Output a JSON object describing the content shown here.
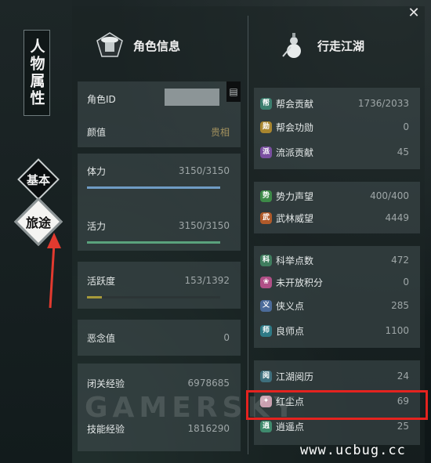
{
  "sidebar": {
    "title": "人物属性",
    "tabs": [
      {
        "label": "基本"
      },
      {
        "label": "旅途"
      }
    ]
  },
  "left_panel": {
    "header": "角色信息",
    "rows": [
      {
        "label": "角色ID",
        "value": ""
      },
      {
        "label": "颜值",
        "value": "贵相"
      },
      {
        "label": "体力",
        "value": "3150/3150"
      },
      {
        "label": "活力",
        "value": "3150/3150"
      },
      {
        "label": "活跃度",
        "value": "153/1392"
      },
      {
        "label": "恶念值",
        "value": "0"
      },
      {
        "label": "闭关经验",
        "value": "6978685"
      },
      {
        "label": "技能经验",
        "value": "1816290"
      }
    ],
    "bars": {
      "stamina": {
        "fraction": 1.0,
        "color": "#6f9cc4"
      },
      "vitality": {
        "fraction": 1.0,
        "color": "#5aa27d"
      },
      "activity": {
        "fraction": 0.11,
        "color": "#a79a3a"
      }
    }
  },
  "right_panel": {
    "header": "行走江湖",
    "groups": [
      [
        {
          "icon": "guild-contribution-icon",
          "badge": "帮",
          "color": "#3c7e6e",
          "label": "帮会贡献",
          "value": "1736/2033"
        },
        {
          "icon": "guild-merit-icon",
          "badge": "勋",
          "color": "#a9862f",
          "label": "帮会功勋",
          "value": "0"
        },
        {
          "icon": "sect-contribution-icon",
          "badge": "派",
          "color": "#7a4fa0",
          "label": "流派贡献",
          "value": "45"
        }
      ],
      [
        {
          "icon": "faction-prestige-icon",
          "badge": "势",
          "color": "#3d8a48",
          "label": "势力声望",
          "value": "400/400"
        },
        {
          "icon": "martial-prestige-icon",
          "badge": "武",
          "color": "#b05a2a",
          "label": "武林威望",
          "value": "4449"
        }
      ],
      [
        {
          "icon": "exam-points-icon",
          "badge": "科",
          "color": "#3f7d5e",
          "label": "科举点数",
          "value": "472"
        },
        {
          "icon": "unopened-points-icon",
          "badge": "❀",
          "color": "#b04f86",
          "label": "未开放积分",
          "value": "0"
        },
        {
          "icon": "chivalry-points-icon",
          "badge": "义",
          "color": "#4b6b9a",
          "label": "侠义点",
          "value": "285"
        },
        {
          "icon": "mentor-points-icon",
          "badge": "师",
          "color": "#2f7a86",
          "label": "良师点",
          "value": "1100"
        }
      ],
      [
        {
          "icon": "jianghu-experience-icon",
          "badge": "阅",
          "color": "#3e6f7d",
          "label": "江湖阅历",
          "value": "24"
        },
        {
          "icon": "red-dust-points-icon",
          "badge": "✦",
          "color": "#c9a0b0",
          "label": "红尘点",
          "value": "69"
        },
        {
          "icon": "leisure-points-icon",
          "badge": "逍",
          "color": "#3f8a6d",
          "label": "逍遥点",
          "value": "25"
        }
      ]
    ]
  },
  "watermarks": {
    "gamersky": "GAMERSKY",
    "site": "www.ucbug.cc"
  },
  "close_label": "✕"
}
